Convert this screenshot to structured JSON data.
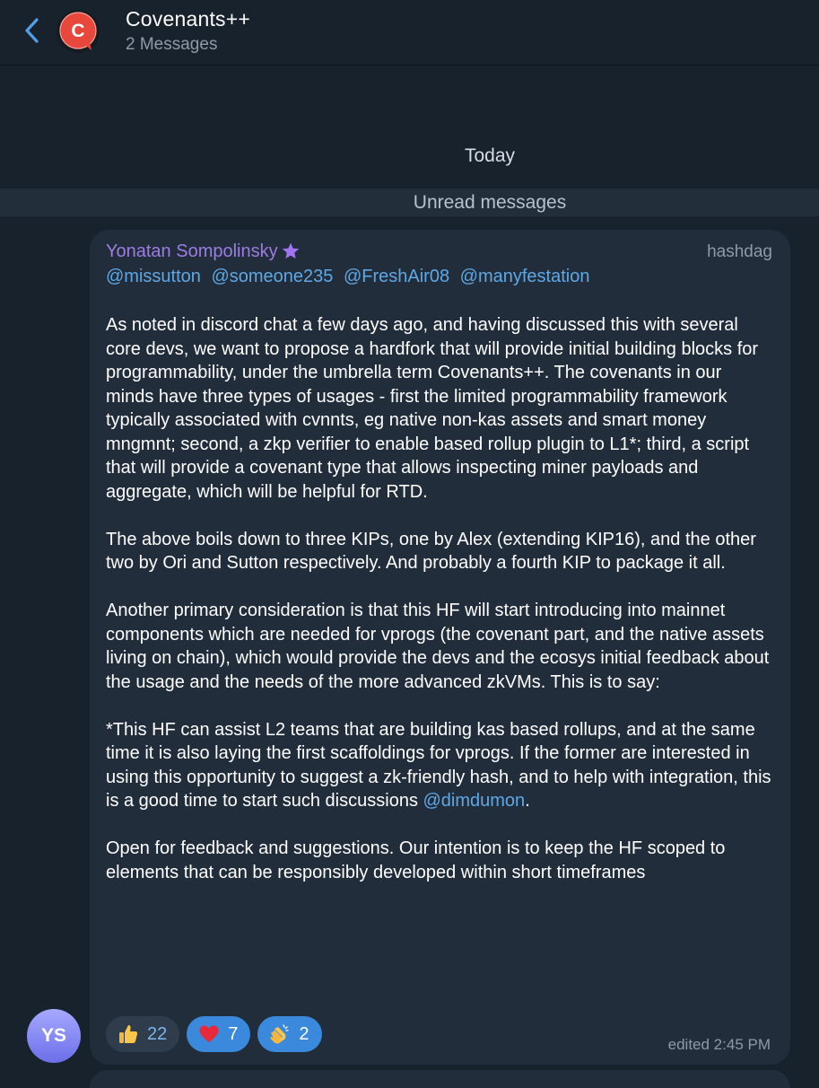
{
  "header": {
    "title": "Covenants++",
    "subtitle": "2 Messages",
    "avatar_letter": "C"
  },
  "chat": {
    "date_separator": "Today",
    "unread_separator": "Unread messages"
  },
  "message": {
    "sender": "Yonatan Sompolinsky",
    "sender_tag": "hashdag",
    "mentions": [
      "@missutton",
      "@someone235",
      "@FreshAir08",
      "@manyfestation"
    ],
    "paragraphs": [
      "As noted in discord chat a few days ago, and having discussed this with several core devs, we want to propose a hardfork that will provide initial building blocks for programmability, under the umbrella term Covenants++. The covenants in our minds have three types of usages - first the limited programmability framework typically associated with cvnnts, eg native non-kas assets and smart money mngmnt; second, a zkp verifier to enable based rollup plugin to L1*; third, a script that will provide a covenant type that allows inspecting miner payloads and aggregate, which will be helpful for RTD.",
      "The above boils down to three KIPs, one by Alex (extending KIP16), and the other two by Ori and Sutton respectively. And probably a fourth KIP to package it all.",
      "Another primary consideration is that this HF will start introducing into mainnet components which are needed for vprogs (the covenant part, and the native assets living on chain), which would provide the devs and the ecosys initial feedback about the usage and the needs of the more advanced zkVMs. This is to say:"
    ],
    "paragraph4_text": "*This HF can assist L2 teams that are building kas based rollups, and at the same time it is also laying the first scaffoldings for vprogs. If the former are interested in using this opportunity to suggest a zk-friendly hash, and to help with integration, this is a good time to start such discussions ",
    "paragraph4_mention": "@dimdumon",
    "paragraph4_end": ".",
    "paragraph5": "Open for feedback and suggestions. Our intention is to keep the HF scoped to elements that can be responsibly developed within short timeframes",
    "reactions": [
      {
        "emoji": "thumbs-up-icon",
        "count": "22"
      },
      {
        "emoji": "heart-icon",
        "count": "7"
      },
      {
        "emoji": "clapping-hands-icon",
        "count": "2"
      }
    ],
    "timestamp": "edited 2:45 PM",
    "avatar_initials": "YS"
  },
  "colors": {
    "background": "#18222d",
    "bubble": "#212d3b",
    "sender_name": "#9d7ce4",
    "link": "#5fa8e6",
    "secondary_text": "#8e9aa6"
  }
}
